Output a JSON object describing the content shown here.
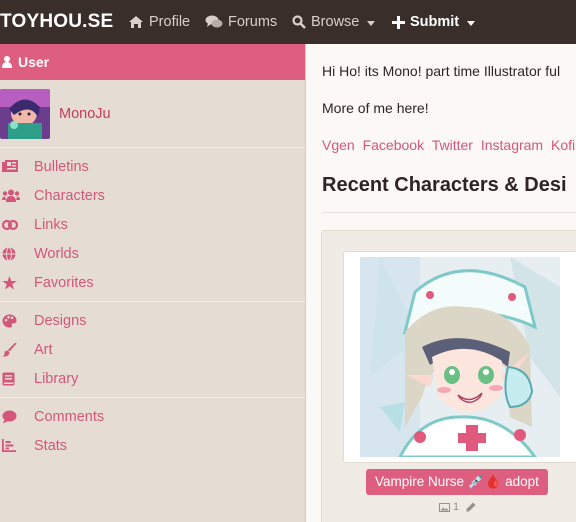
{
  "nav": {
    "brand": "TOYHOU.SE",
    "profile": "Profile",
    "forums": "Forums",
    "browse": "Browse",
    "submit": "Submit"
  },
  "sidebar": {
    "header": "User",
    "username": "MonoJu",
    "group1": [
      {
        "label": "Bulletins",
        "icon": "newspaper-icon"
      },
      {
        "label": "Characters",
        "icon": "users-icon"
      },
      {
        "label": "Links",
        "icon": "link-icon"
      },
      {
        "label": "Worlds",
        "icon": "globe-icon"
      },
      {
        "label": "Favorites",
        "icon": "star-icon"
      }
    ],
    "group2": [
      {
        "label": "Designs",
        "icon": "palette-icon"
      },
      {
        "label": "Art",
        "icon": "brush-icon"
      },
      {
        "label": "Library",
        "icon": "book-icon"
      }
    ],
    "group3": [
      {
        "label": "Comments",
        "icon": "comment-icon"
      },
      {
        "label": "Stats",
        "icon": "bar-chart-icon"
      }
    ]
  },
  "main": {
    "bio": "Hi Ho! its Mono!  part time Illustrator ful",
    "more": "More of me here!",
    "links": [
      "Vgen",
      "Facebook",
      "Twitter",
      "Instagram",
      "Kofi"
    ],
    "section_title": "Recent Characters & Desi",
    "card": {
      "name": "Vampire Nurse 💉🩸 adopt",
      "image_count": "1"
    }
  },
  "colors": {
    "accent": "#dd5e7e",
    "nav_bg": "#3a2e2a",
    "sidebar_bg": "#e5ddd4",
    "link": "#d4567a"
  }
}
